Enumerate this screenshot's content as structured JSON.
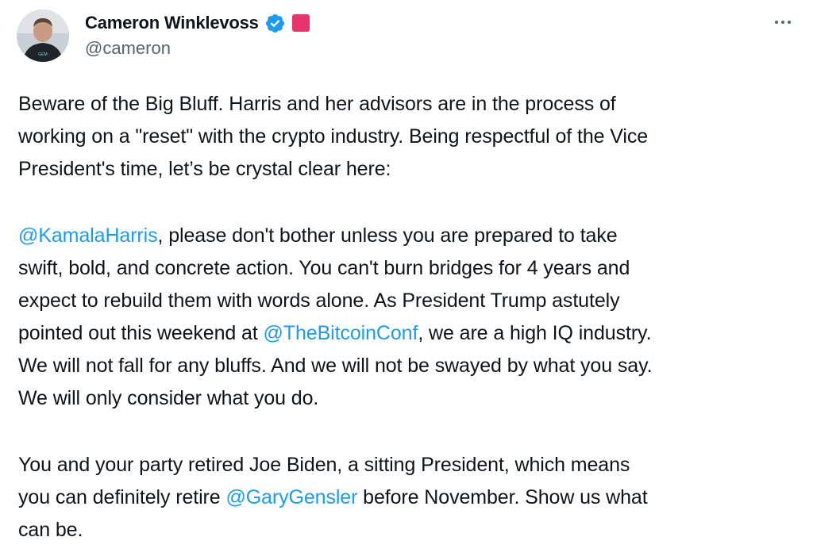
{
  "author": {
    "display_name": "Cameron Winklevoss",
    "handle": "@cameron",
    "avatar_icon": "profile-photo",
    "verified_icon": "verified-badge-icon",
    "verified_color": "#1d9bf0",
    "affiliate_color": "#e8336e"
  },
  "menu": {
    "icon": "more-horizontal-icon"
  },
  "tweet": {
    "p1": {
      "l1": "Beware of the Big Bluff. Harris and her advisors are in the process of",
      "l2": "working on a \"reset\" with the crypto industry. Being respectful of the Vice",
      "l3": "President's time, let’s be crystal clear here:"
    },
    "p2": {
      "l1_mention": "@KamalaHarris",
      "l1_text": ", please don't bother unless you are prepared to take",
      "l2": "swift, bold, and concrete action. You can't burn bridges for 4 years and",
      "l3": "expect to rebuild them with words alone. As President Trump astutely",
      "l4_text_a": "pointed out this weekend at ",
      "l4_mention": "@TheBitcoinConf",
      "l4_text_b": ", we are a high IQ industry.",
      "l5": "We will not fall for any bluffs. And we will not be swayed by what you say.",
      "l6": "We will only consider what you do."
    },
    "p3": {
      "l1": "You and your party retired Joe Biden, a sitting President, which means",
      "l2_text_a": "you can definitely retire ",
      "l2_mention": "@GaryGensler",
      "l2_text_b": " before November. Show us what",
      "l3": "can be."
    }
  },
  "colors": {
    "text": "#0f1419",
    "secondary": "#536471",
    "link": "#1d9bf0"
  }
}
